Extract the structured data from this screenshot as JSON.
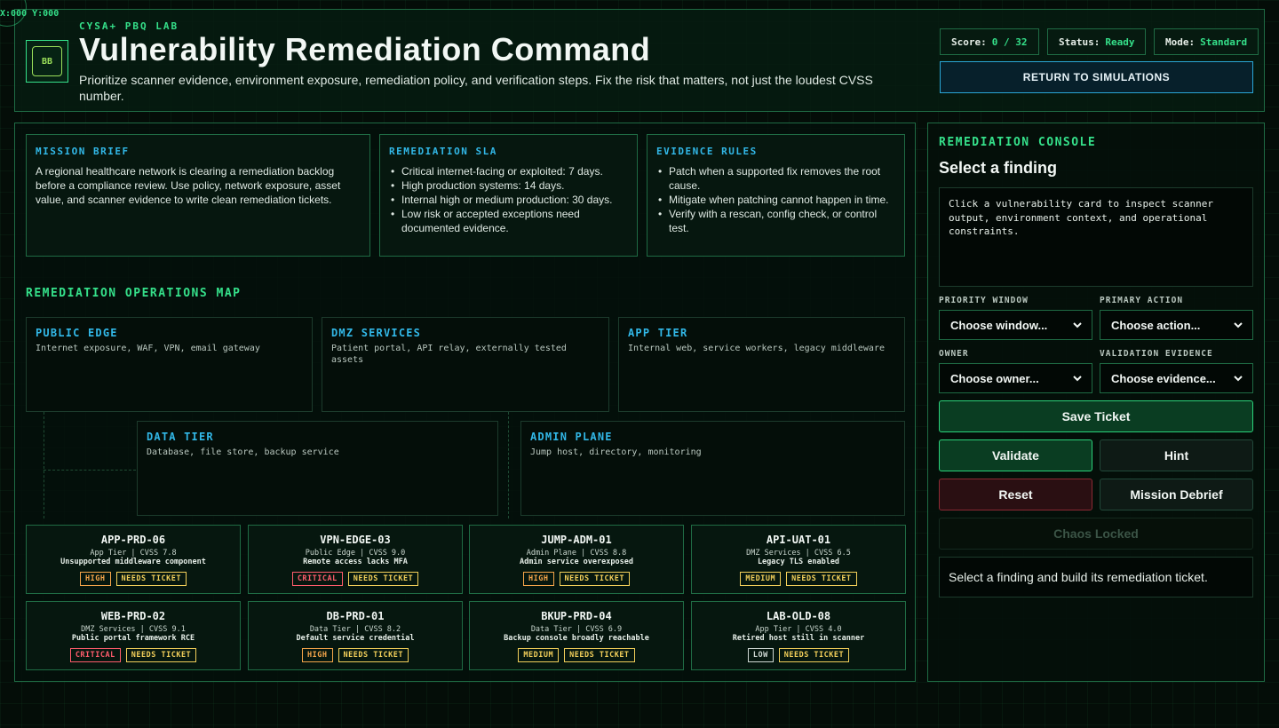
{
  "coords": "X:000 Y:000",
  "header": {
    "logo_text": "BB",
    "kicker": "CYSA+ PBQ LAB",
    "title": "Vulnerability Remediation Command",
    "subtitle": "Prioritize scanner evidence, environment exposure, remediation policy, and verification steps. Fix the risk that matters, not just the loudest CVSS number.",
    "stats": {
      "score_label": "Score:",
      "score_value": "0 / 32",
      "status_label": "Status:",
      "status_value": "Ready",
      "mode_label": "Mode:",
      "mode_value": "Standard"
    },
    "return_label": "RETURN TO SIMULATIONS"
  },
  "brief": {
    "mission": {
      "title": "MISSION BRIEF",
      "text": "A regional healthcare network is clearing a remediation backlog before a compliance review. Use policy, network exposure, asset value, and scanner evidence to write clean remediation tickets."
    },
    "sla": {
      "title": "REMEDIATION SLA",
      "items": [
        "Critical internet-facing or exploited: 7 days.",
        "High production systems: 14 days.",
        "Internal high or medium production: 30 days.",
        "Low risk or accepted exceptions need documented evidence."
      ]
    },
    "evidence": {
      "title": "EVIDENCE RULES",
      "items": [
        "Patch when a supported fix removes the root cause.",
        "Mitigate when patching cannot happen in time.",
        "Verify with a rescan, config check, or control test."
      ]
    }
  },
  "map": {
    "title": "REMEDIATION OPERATIONS MAP",
    "zones": [
      {
        "name": "PUBLIC EDGE",
        "desc": "Internet exposure, WAF, VPN, email gateway"
      },
      {
        "name": "DMZ SERVICES",
        "desc": "Patient portal, API relay, externally tested assets"
      },
      {
        "name": "APP TIER",
        "desc": "Internal web, service workers, legacy middleware"
      },
      {
        "name": "DATA TIER",
        "desc": "Database, file store, backup service"
      },
      {
        "name": "ADMIN PLANE",
        "desc": "Jump host, directory, monitoring"
      }
    ]
  },
  "findings": [
    {
      "id": "APP-PRD-06",
      "meta": "App Tier | CVSS 7.8",
      "summary": "Unsupported middleware component",
      "severity": "HIGH",
      "sev_class": "b-high",
      "ticket": "NEEDS TICKET"
    },
    {
      "id": "VPN-EDGE-03",
      "meta": "Public Edge | CVSS 9.0",
      "summary": "Remote access lacks MFA",
      "severity": "CRITICAL",
      "sev_class": "b-critical",
      "ticket": "NEEDS TICKET"
    },
    {
      "id": "JUMP-ADM-01",
      "meta": "Admin Plane | CVSS 8.8",
      "summary": "Admin service overexposed",
      "severity": "HIGH",
      "sev_class": "b-high",
      "ticket": "NEEDS TICKET"
    },
    {
      "id": "API-UAT-01",
      "meta": "DMZ Services | CVSS 6.5",
      "summary": "Legacy TLS enabled",
      "severity": "MEDIUM",
      "sev_class": "b-medium",
      "ticket": "NEEDS TICKET"
    },
    {
      "id": "WEB-PRD-02",
      "meta": "DMZ Services | CVSS 9.1",
      "summary": "Public portal framework RCE",
      "severity": "CRITICAL",
      "sev_class": "b-critical",
      "ticket": "NEEDS TICKET"
    },
    {
      "id": "DB-PRD-01",
      "meta": "Data Tier | CVSS 8.2",
      "summary": "Default service credential",
      "severity": "HIGH",
      "sev_class": "b-high",
      "ticket": "NEEDS TICKET"
    },
    {
      "id": "BKUP-PRD-04",
      "meta": "Data Tier | CVSS 6.9",
      "summary": "Backup console broadly reachable",
      "severity": "MEDIUM",
      "sev_class": "b-medium",
      "ticket": "NEEDS TICKET"
    },
    {
      "id": "LAB-OLD-08",
      "meta": "App Tier | CVSS 4.0",
      "summary": "Retired host still in scanner",
      "severity": "LOW",
      "sev_class": "b-low",
      "ticket": "NEEDS TICKET"
    }
  ],
  "console": {
    "title": "REMEDIATION CONSOLE",
    "subtitle": "Select a finding",
    "detail": "Click a vulnerability card to inspect scanner output, environment context, and operational constraints.",
    "fields": {
      "priority_label": "PRIORITY WINDOW",
      "priority_value": "Choose window...",
      "action_label": "PRIMARY ACTION",
      "action_value": "Choose action...",
      "owner_label": "OWNER",
      "owner_value": "Choose owner...",
      "evidence_label": "VALIDATION EVIDENCE",
      "evidence_value": "Choose evidence..."
    },
    "buttons": {
      "save": "Save Ticket",
      "validate": "Validate",
      "hint": "Hint",
      "reset": "Reset",
      "debrief": "Mission Debrief",
      "chaos": "Chaos Locked"
    },
    "status": "Select a finding and build its remediation ticket."
  }
}
